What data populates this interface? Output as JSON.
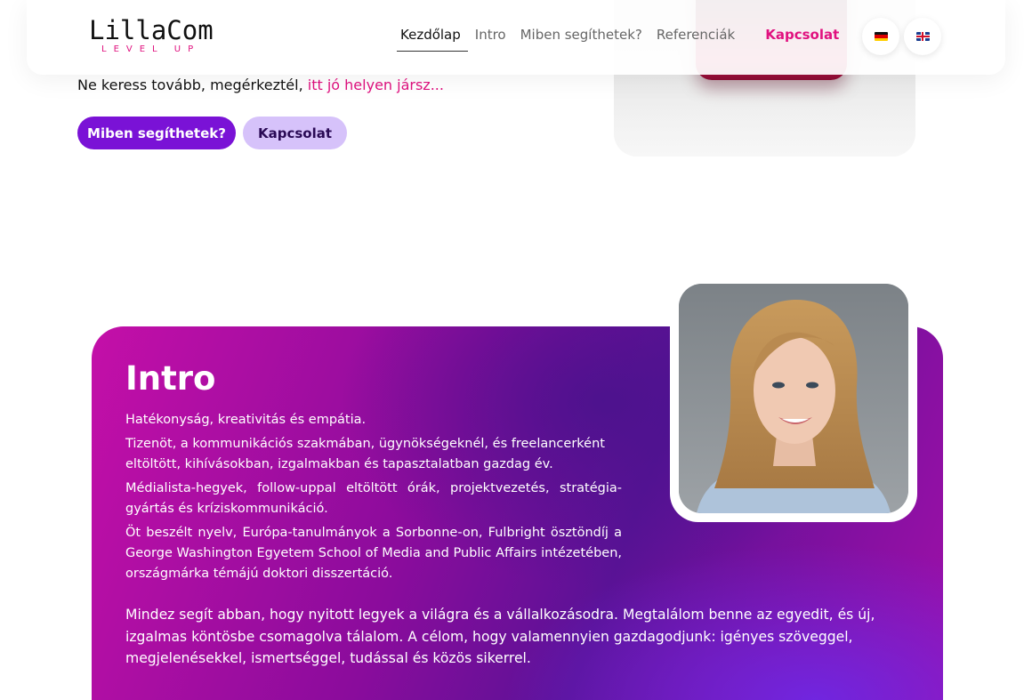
{
  "header": {
    "logo_main": "LillaCom",
    "logo_sub": "LEVEL UP",
    "nav": [
      {
        "label": "Kezdőlap",
        "active": true
      },
      {
        "label": "Intro",
        "active": false
      },
      {
        "label": "Miben segíthetek?",
        "active": false
      },
      {
        "label": "Referenciák",
        "active": false
      }
    ],
    "contact_label": "Kapcsolat",
    "languages": [
      {
        "icon": "flag-de-icon",
        "code": "de"
      },
      {
        "icon": "flag-uk-icon",
        "code": "en"
      }
    ]
  },
  "hero": {
    "tagline": "Ne keress tovább, megérkeztél, ",
    "tagline_accent": "itt jó helyen jársz...",
    "primary_button": "Miben segíthetek?",
    "secondary_button": "Kapcsolat"
  },
  "intro": {
    "title": "Intro",
    "paragraphs": [
      "Hatékonyság, kreativitás és empátia.",
      "Tizenöt, a kommunikációs szakmában, ügynökségeknél, és freelancerként",
      "eltöltött, kihívásokban, izgalmakban és tapasztalatban gazdag év.",
      "Médialista-hegyek, follow-uppal eltöltött órák, projektvezetés, stratégia-gyártás és kríziskommunikáció.",
      "Öt beszélt nyelv, Európa-tanulmányok a Sorbonne-on, Fulbright ösztöndíj a George Washington Egyetem School of Media and Public Affairs intézetében, országmárka témájú doktori disszertáció."
    ],
    "closing": "Mindez segít abban, hogy nyitott legyek a világra és a vállalkozásodra. Megtalálom benne az egyedit, és új, izgalmas köntösbe csomagolva tálalom. A célom, hogy valamennyien gazdagodjunk: igényes szöveggel, megjelenésekkel, ismertséggel, tudással és közös sikerrel."
  },
  "colors": {
    "accent_pink": "#e0117f",
    "primary_purple": "#7a12d6",
    "secondary_lavender": "#d6c2fa"
  }
}
